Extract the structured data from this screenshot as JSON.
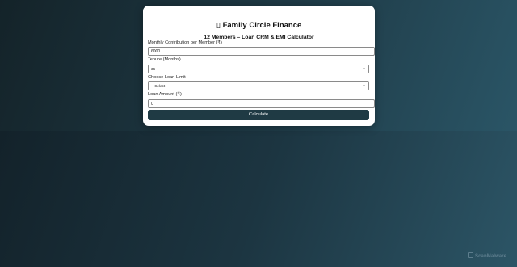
{
  "app": {
    "title": "Family Circle Finance",
    "title_icon": "▯",
    "subtitle": "12 Members – Loan CRM & EMI Calculator"
  },
  "form": {
    "contribution": {
      "label": "Monthly Contribution per Member (₹)",
      "value": "6000"
    },
    "tenure": {
      "label": "Tenure (Months)",
      "value": "36"
    },
    "loan_limit": {
      "label": "Choose Loan Limit",
      "value": "-- Select --"
    },
    "loan_amount": {
      "label": "Loan Amount (₹)",
      "value": "0"
    },
    "calculate_label": "Calculate"
  },
  "watermark": {
    "text": "ScanMalware"
  }
}
